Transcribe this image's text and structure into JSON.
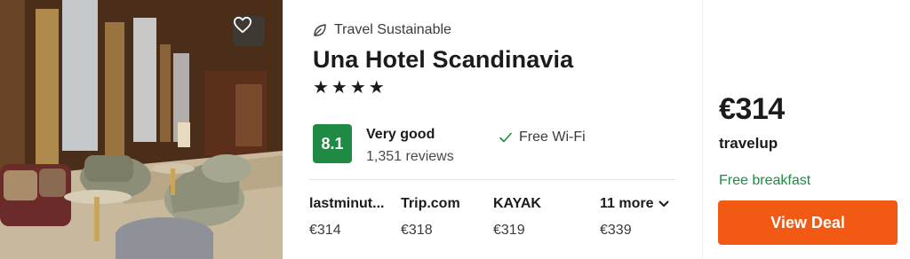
{
  "hotel": {
    "sustainability_label": "Travel Sustainable",
    "name": "Una Hotel Scandinavia",
    "stars_display": "★★★★",
    "star_count": 4
  },
  "rating": {
    "score": "8.1",
    "word": "Very good",
    "reviews": "1,351 reviews"
  },
  "amenities": [
    {
      "label": "Free Wi-Fi",
      "icon": "check-icon"
    }
  ],
  "providers": [
    {
      "name": "lastminut...",
      "price": "€314"
    },
    {
      "name": "Trip.com",
      "price": "€318"
    },
    {
      "name": "KAYAK",
      "price": "€319"
    },
    {
      "name": "11 more",
      "price": "€339",
      "icon": "chevron-down-icon"
    }
  ],
  "deal": {
    "price": "€314",
    "site": "travelup",
    "perk": "Free breakfast",
    "button_label": "View Deal"
  },
  "colors": {
    "rating_badge": "#1f8a43",
    "perk_text": "#1f8a43",
    "cta": "#f25a14"
  },
  "icons": {
    "favorite": "heart-icon",
    "sustainability": "leaf-icon"
  }
}
